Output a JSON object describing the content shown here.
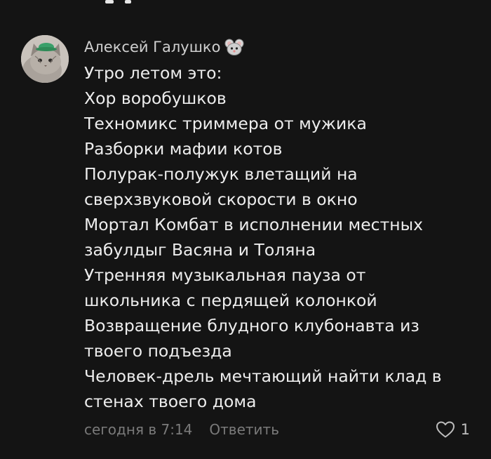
{
  "comment": {
    "author": {
      "name": "Алексей Галушко",
      "badge_icon": "mouse-icon",
      "avatar": "cat-avatar"
    },
    "lines": [
      "Утро летом это:",
      "Хор воробушков",
      "Техномикс триммера от мужика",
      "Разборки мафии котов",
      "Полурак-полужук влетащий на",
      "сверхзвуковой скорости в окно",
      "Мортал Комбат в исполнении местных",
      "забулдыг Васяна и Толяна",
      "Утренняя музыкальная пауза от",
      "школьника с пердящей колонкой",
      "Возвращение блудного клубонавта из",
      "твоего подъезда",
      "Человек-дрель мечтающий найти клад в",
      "стенах твоего дома"
    ],
    "timestamp": "сегодня в 7:14",
    "reply_label": "Ответить",
    "like_count": "1",
    "like_icon": "heart-outline-icon"
  },
  "colors": {
    "background": "#141414",
    "text_primary": "#ededed",
    "text_author": "#cfcfcf",
    "text_muted": "#7a7a7a"
  }
}
